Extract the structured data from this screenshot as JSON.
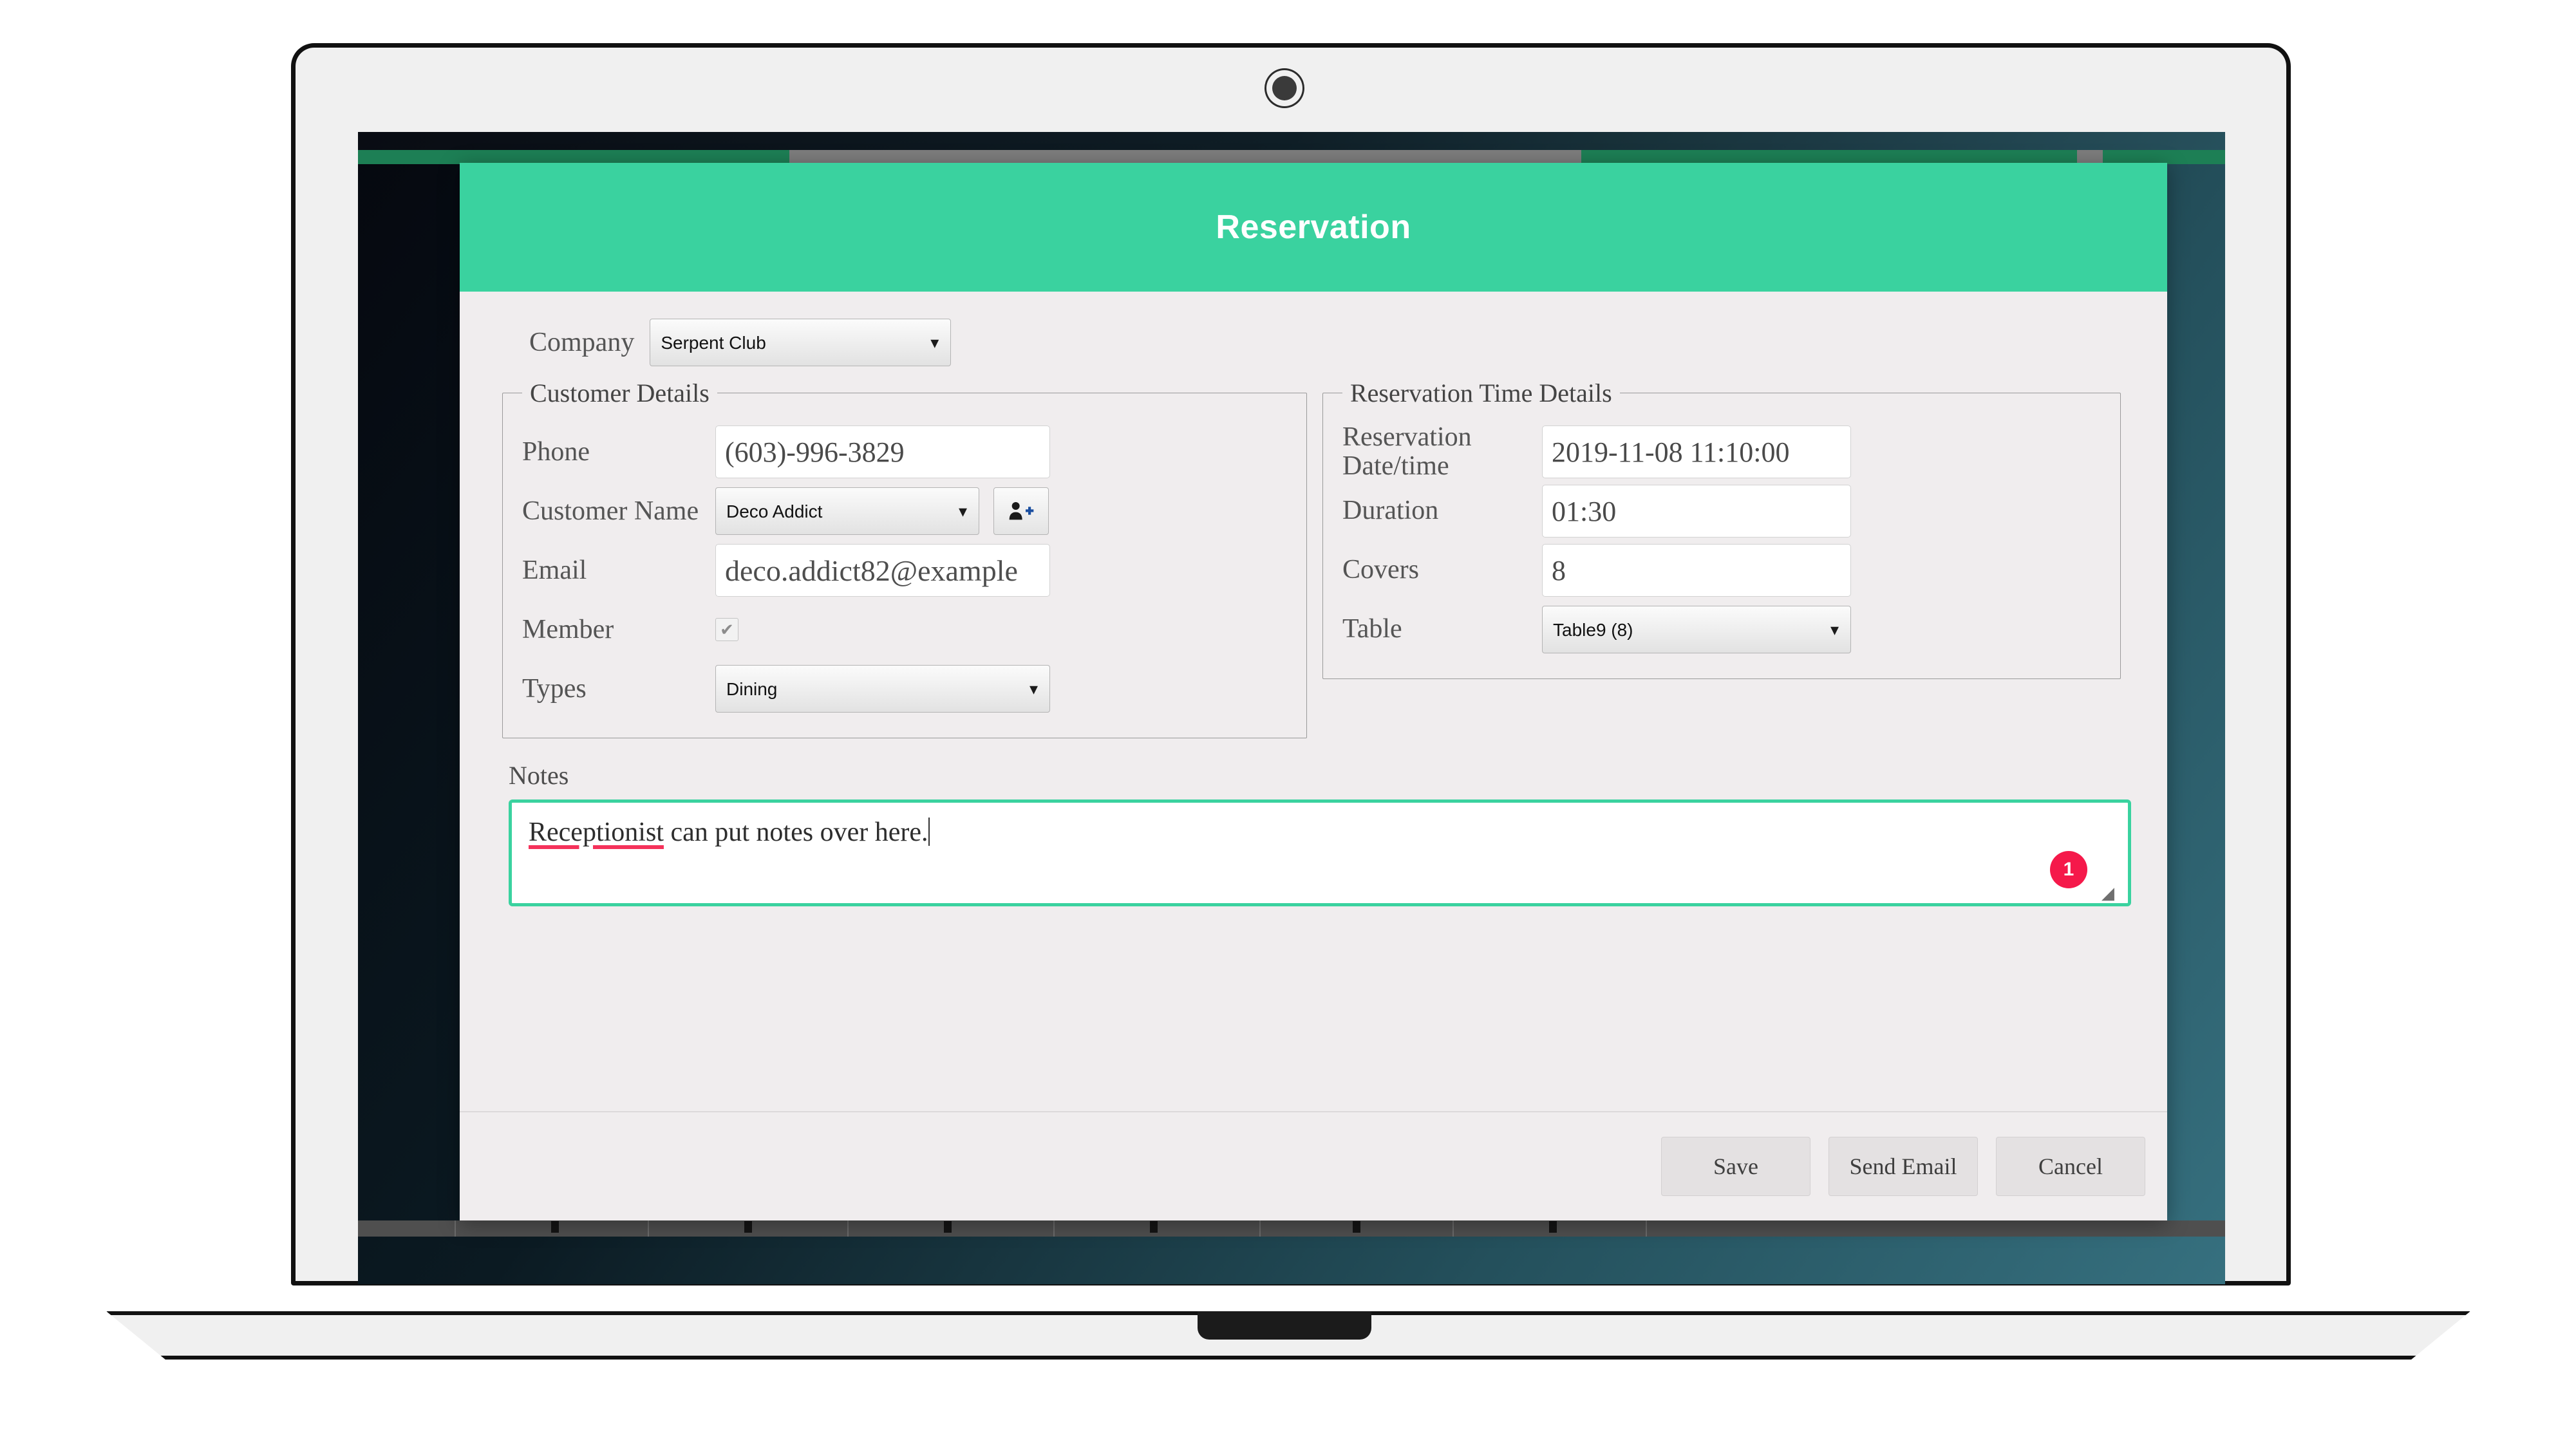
{
  "dialog": {
    "title": "Reservation",
    "accent_color": "#3ad29f",
    "body_bg": "#f0edee"
  },
  "company": {
    "label": "Company",
    "value": "Serpent Club",
    "caret": "▾"
  },
  "customer_details": {
    "legend": "Customer Details",
    "phone": {
      "label": "Phone",
      "value": "(603)-996-3829"
    },
    "customer_name": {
      "label": "Customer Name",
      "value": "Deco Addict",
      "caret": "▾"
    },
    "add_customer_icon": "add-user-icon",
    "email": {
      "label": "Email",
      "value": "deco.addict82@example"
    },
    "member": {
      "label": "Member",
      "checked": true,
      "check_glyph": "✔"
    },
    "types": {
      "label": "Types",
      "value": "Dining",
      "caret": "▾"
    }
  },
  "reservation_time_details": {
    "legend": "Reservation Time Details",
    "datetime": {
      "label": "Reservation Date/time",
      "value": "2019-11-08 11:10:00"
    },
    "duration": {
      "label": "Duration",
      "value": "01:30"
    },
    "covers": {
      "label": "Covers",
      "value": "8"
    },
    "table": {
      "label": "Table",
      "value": "Table9 (8)",
      "caret": "▾"
    }
  },
  "notes": {
    "label": "Notes",
    "misspelled_word": "Receptionist",
    "rest_text": " can put notes over here.",
    "badge_count": "1",
    "badge_color": "#f5194a",
    "resize_glyph": "◢"
  },
  "footer": {
    "save_label": "Save",
    "send_email_label": "Send Email",
    "cancel_label": "Cancel"
  }
}
